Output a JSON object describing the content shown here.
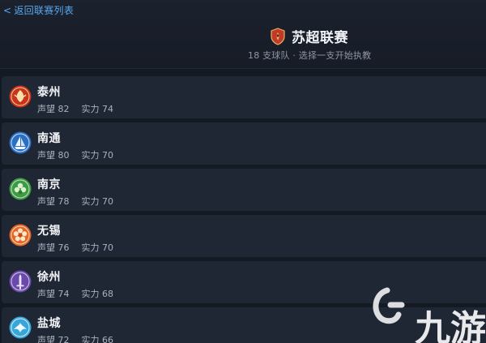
{
  "header": {
    "back_label": "返回联赛列表",
    "league_title": "苏超联赛",
    "subtitle": "18 支球队 · 选择一支开始执教"
  },
  "stats_labels": {
    "reputation": "声望",
    "strength": "实力"
  },
  "teams": [
    {
      "name": "泰州",
      "reputation": "82",
      "strength": "74",
      "crest": "red-phoenix-crest-icon",
      "color": "#c8321e"
    },
    {
      "name": "南通",
      "reputation": "80",
      "strength": "70",
      "crest": "blue-ship-crest-icon",
      "color": "#2a6fc2"
    },
    {
      "name": "南京",
      "reputation": "78",
      "strength": "70",
      "crest": "green-leaf-crest-icon",
      "color": "#3e9a45"
    },
    {
      "name": "无锡",
      "reputation": "76",
      "strength": "70",
      "crest": "orange-flower-crest-icon",
      "color": "#e2662a"
    },
    {
      "name": "徐州",
      "reputation": "74",
      "strength": "68",
      "crest": "purple-sword-crest-icon",
      "color": "#6a4aa8"
    },
    {
      "name": "盐城",
      "reputation": "72",
      "strength": "66",
      "crest": "cyan-bird-crest-icon",
      "color": "#38a6d8"
    }
  ],
  "watermark": {
    "text": "九游"
  }
}
